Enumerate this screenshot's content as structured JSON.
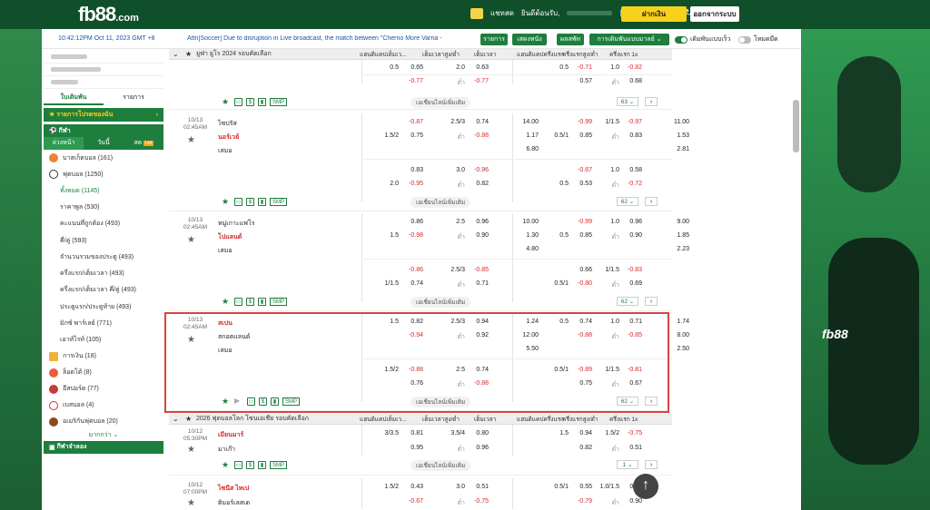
{
  "header": {
    "logo_main": "fb88",
    "logo_suffix": ".com",
    "user_label": "แชทสด",
    "welcome": "ยินดีต้อนรับ,",
    "deposit": "ฝากเงิน",
    "logout": "ออกจากระบบ"
  },
  "infobar": {
    "time": "10:42:12PM Oct 11, 2023 GMT +8",
    "ticker": "Attn[Soccer] Due to disruption in Live broadcast, the match between \"Cherno More Varna -",
    "btn_items": "รายการ",
    "btn_results": "เสดงหนัง",
    "btn_parlay": "ผลสพัท",
    "btn_betmode": "การเดิมพันแบบมาลย์",
    "toggle_quick": "เดิมพันแบบเร็ว",
    "toggle_dark": "โหมดมืด"
  },
  "sidebar": {
    "tabs": [
      "ใบเดิมพัน",
      "รายการ"
    ],
    "promo": "รายการโปรดของฉัน",
    "sports": "กีฬา",
    "subtabs": [
      "ล่วงหน้า",
      "วันนี้",
      "สด"
    ],
    "live_badge": "144",
    "items": [
      {
        "label": "บาสเก็ตบอล (161)"
      },
      {
        "label": "ฟุตบอล (1250)"
      }
    ],
    "subs": [
      "ทั้งหมด (1145)",
      "ราคาพูล (530)",
      "คะแนนที่ถูกต้อง (493)",
      "คี่/คู่ (593)",
      "จำนวนรวมของประตู (493)",
      "ครึ่งแรก/เต็มเวลา (493)",
      "ครึ่งแรก/เต็มเวลา คี่/คู่ (493)",
      "ประตูแรก/ประตูท้าย (493)",
      "มิกซ์ พาร์เลย์ (771)",
      "เอาท์ไรท์ (105)"
    ],
    "others": [
      {
        "label": "การเงิน (18)"
      },
      {
        "label": "ล็อตโต้ (8)"
      },
      {
        "label": "อีสปอร์ต (77)"
      },
      {
        "label": "เบสบอล (4)"
      },
      {
        "label": "อเมริกันฟุตบอล (20)"
      }
    ],
    "more": "มากกว่า",
    "live_casino": "กีฬาจำลอง"
  },
  "league1": {
    "name": "ยูฟ่า ยูโร 2024 รอบคัดเลือก"
  },
  "headers": [
    "แฮนดิแคปเต็มเว...",
    "เต็มเวลาสูง/ต่ำ",
    "เต็มเวลา",
    "แฮนดิแคปครึ่งแรก",
    "ครึ่งแรกสูง/ต่ำ",
    "ครึ่งแรก 1x"
  ],
  "more_bets": "เอเชี่ยนไลน์เพิ่มเติม",
  "matches": [
    {
      "date": "",
      "time": "",
      "home": "",
      "away": "",
      "draw": "",
      "r1": [
        "0.5",
        "0.65",
        "2.0",
        "0.63",
        "",
        "0.5",
        "-0.71",
        "1.0",
        "-0.82",
        ""
      ],
      "r2": [
        "",
        "-0.77",
        "ต่ำ",
        "-0.77",
        "",
        "",
        "0.57",
        "ต่ำ",
        "0.68",
        ""
      ],
      "count": "63"
    },
    {
      "date": "10/13",
      "time": "02:45AM",
      "home": "ไซปรัส",
      "away": "นอร์เวย์",
      "draw": "เสมอ",
      "r1": [
        "",
        "-0.87",
        "2.5/3",
        "0.74",
        "14.00",
        "",
        "-0.99",
        "1/1.5",
        "-0.97",
        "11.00"
      ],
      "r2": [
        "1.5/2",
        "0.75",
        "ต่ำ",
        "-0.88",
        "1.17",
        "0.5/1",
        "0.85",
        "ต่ำ",
        "0.83",
        "1.53"
      ],
      "r3": [
        "",
        "",
        "",
        "",
        "6.80",
        "",
        "",
        "",
        "",
        "2.81"
      ],
      "a1": [
        "",
        "0.83",
        "3.0",
        "-0.96",
        "",
        "",
        "-0.67",
        "1.0",
        "0.58"
      ],
      "a2": [
        "2.0",
        "-0.95",
        "ต่ำ",
        "0.82",
        "",
        "0.5",
        "0.53",
        "ต่ำ",
        "-0.72"
      ],
      "count": "62"
    },
    {
      "date": "10/13",
      "time": "02:45AM",
      "home": "หมู่เกาะแฟโร",
      "away": "โปแลนด์",
      "draw": "เสมอ",
      "r1": [
        "",
        "0.86",
        "2.5",
        "0.96",
        "10.00",
        "",
        "-0.99",
        "1.0",
        "0.96",
        "9.00"
      ],
      "r2": [
        "1.5",
        "-0.98",
        "ต่ำ",
        "0.90",
        "1.30",
        "0.5",
        "0.85",
        "ต่ำ",
        "0.90",
        "1.85"
      ],
      "r3": [
        "",
        "",
        "",
        "",
        "4.80",
        "",
        "",
        "",
        "",
        "2.23"
      ],
      "a1": [
        "",
        "-0.86",
        "2.5/3",
        "-0.85",
        "",
        "",
        "0.66",
        "1/1.5",
        "-0.83"
      ],
      "a2": [
        "1/1.5",
        "0.74",
        "ต่ำ",
        "0.71",
        "",
        "0.5/1",
        "-0.80",
        "ต่ำ",
        "0.69"
      ],
      "count": "62"
    },
    {
      "date": "10/13",
      "time": "02:45AM",
      "home": "สเปน",
      "away": "สกอตแลนด์",
      "draw": "เสมอ",
      "r1": [
        "1.5",
        "0.82",
        "2.5/3",
        "0.94",
        "1.24",
        "0.5",
        "0.74",
        "1.0",
        "0.71",
        "1.74"
      ],
      "r2": [
        "",
        "-0.94",
        "ต่ำ",
        "0.92",
        "12.00",
        "",
        "-0.88",
        "ต่ำ",
        "-0.85",
        "8.00"
      ],
      "r3": [
        "",
        "",
        "",
        "",
        "5.50",
        "",
        "",
        "",
        "",
        "2.50"
      ],
      "a1": [
        "1.5/2",
        "-0.88",
        "2.5",
        "0.74",
        "",
        "0.5/1",
        "-0.89",
        "1/1.5",
        "-0.81"
      ],
      "a2": [
        "",
        "0.76",
        "ต่ำ",
        "-0.88",
        "",
        "",
        "0.75",
        "ต่ำ",
        "0.67"
      ],
      "count": "62"
    }
  ],
  "league2": {
    "name": "2026 ฟุตบอลโลก โซนเอเชีย รอบคัดเลือก"
  },
  "matches2": [
    {
      "date": "10/12",
      "time": "05:30PM",
      "home": "เมียนมาร์",
      "away": "มาเก๊า",
      "r1": [
        "3/3.5",
        "0.81",
        "3.5/4",
        "0.80",
        "",
        "1.5",
        "0.94",
        "1.5/2",
        "-0.75",
        ""
      ],
      "r2": [
        "",
        "0.95",
        "ต่ำ",
        "0.96",
        "",
        "",
        "0.82",
        "ต่ำ",
        "0.51",
        ""
      ],
      "count": "1"
    },
    {
      "date": "10/12",
      "time": "07:00PM",
      "home": "ไซนีส ไทเป",
      "away": "ติมอร์เลสเต",
      "r1": [
        "1.5/2",
        "0.43",
        "3.0",
        "0.51",
        "",
        "0.5/1",
        "0.55",
        "1.0/1.5",
        "0.88",
        ""
      ],
      "r2": [
        "",
        "-0.67",
        "ต่ำ",
        "-0.75",
        "",
        "",
        "-0.79",
        "ต่ำ",
        "0.90",
        ""
      ],
      "count": ""
    }
  ],
  "colors": {
    "brand": "#1e7e3e",
    "negative": "#d42a2a",
    "accent": "#f7d21a"
  }
}
